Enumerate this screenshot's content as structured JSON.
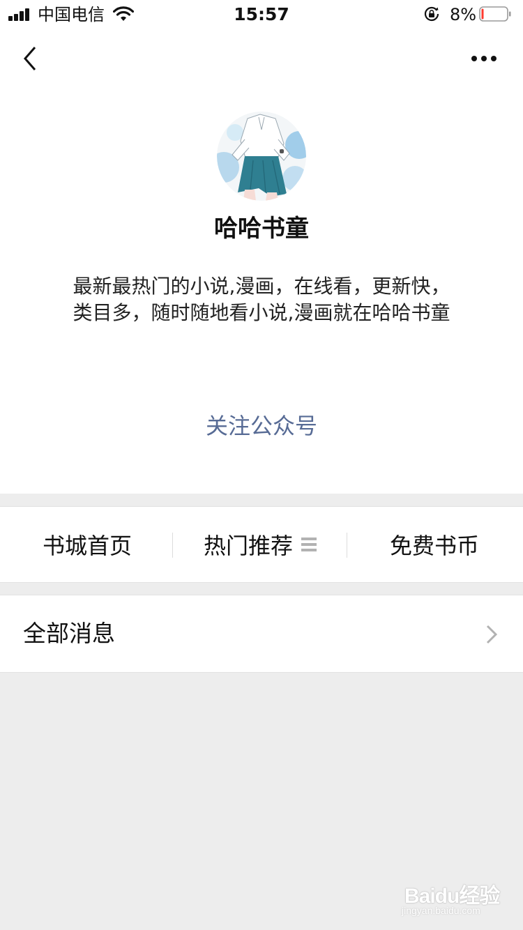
{
  "status_bar": {
    "carrier": "中国电信",
    "time": "15:57",
    "battery_percent": "8%",
    "battery_level": 0.08,
    "signal_bars": 4,
    "icons": [
      "signal-icon",
      "wifi-icon",
      "rotation-lock-icon",
      "battery-icon"
    ]
  },
  "nav_bar": {
    "icons": [
      "back-arrow-icon",
      "more-dots-icon"
    ]
  },
  "profile": {
    "name": "哈哈书童",
    "description": "最新最热门的小说,漫画，在线看，更新快，类目多，随时随地看小说,漫画就在哈哈书童",
    "follow_label": "关注公众号"
  },
  "menu": {
    "items": [
      {
        "label": "书城首页"
      },
      {
        "label": "热门推荐",
        "icon": "submenu-list-icon"
      },
      {
        "label": "免费书币"
      }
    ]
  },
  "all_messages": {
    "label": "全部消息",
    "icon": "chevron-right-icon"
  },
  "watermark": {
    "text": "Baidu经验",
    "subtext": "jingyan.baidu.com"
  },
  "colors": {
    "link": "#576b95",
    "page_bg": "#ededed",
    "battery_low": "#ff3b30",
    "submenu_icon": "#b2b2b2"
  }
}
